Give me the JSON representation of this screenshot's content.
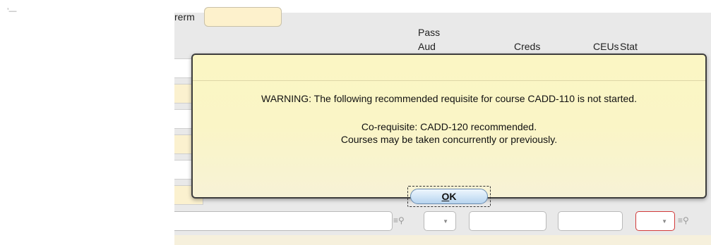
{
  "background_form": {
    "corner_mark": "’—",
    "term_label": "rerm",
    "columns": {
      "pass": "Pass",
      "aud": "Aud",
      "creds": "Creds",
      "ceus": "CEUs",
      "stat": "Stat"
    }
  },
  "dialog": {
    "warning": "WARNING: The following recommended requisite for course CADD-110 is not started.",
    "coreq": "Co-requisite: CADD-120 recommended.",
    "concurrent": "Courses may be taken concurrently or previously.",
    "ok_mnemonic": "O",
    "ok_rest": "K"
  },
  "icons": {
    "lookup": "lookup-icon",
    "dropdown": "chevron-down-icon"
  }
}
